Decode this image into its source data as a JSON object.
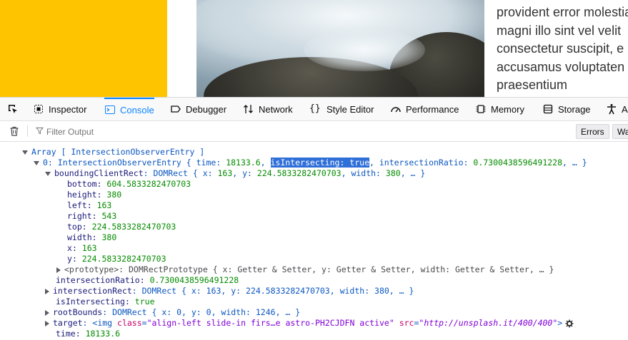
{
  "page": {
    "text_lines": [
      "provident error molestiae",
      "magni illo sint vel velit",
      "consectetur suscipit, e",
      "accusamus voluptaten",
      "praesentium"
    ]
  },
  "devtools": {
    "tabs": [
      {
        "label": "Inspector",
        "icon": "inspector-icon"
      },
      {
        "label": "Console",
        "icon": "console-icon",
        "active": true
      },
      {
        "label": "Debugger",
        "icon": "debugger-icon"
      },
      {
        "label": "Network",
        "icon": "network-icon"
      },
      {
        "label": "Style Editor",
        "icon": "style-editor-icon"
      },
      {
        "label": "Performance",
        "icon": "performance-icon"
      },
      {
        "label": "Memory",
        "icon": "memory-icon"
      },
      {
        "label": "Storage",
        "icon": "storage-icon"
      },
      {
        "label": "A",
        "icon": "accessibility-icon"
      }
    ],
    "filter": {
      "placeholder": "Filter Output"
    },
    "buttons": {
      "errors": "Errors",
      "warnings": "Wa"
    },
    "colors": {
      "accent": "#0a84ff",
      "yellow_block": "#ffc400",
      "selection": "#2f6fd8"
    }
  },
  "console": {
    "array_label": "Array [ IntersectionObserverEntry ]",
    "entry_prefix": "0: IntersectionObserverEntry { time: ",
    "entry_time": "18133.6",
    "entry_sep": ", ",
    "entry_selected": "isIntersecting: true",
    "entry_ratio_key": ", intersectionRatio: ",
    "entry_ratio": "0.7300438596491228",
    "entry_suffix": ", … }",
    "bcr_key": "boundingClientRect",
    "bcr_summary_prefix": ": DOMRect { x: ",
    "bcr_x": "163",
    "bcr_y_key": ", y: ",
    "bcr_y": "224.5833282470703",
    "bcr_w_key": ", width: ",
    "bcr_w": "380",
    "bcr_end": ", … }",
    "props": [
      {
        "key": "bottom",
        "value": "604.5833282470703"
      },
      {
        "key": "height",
        "value": "380"
      },
      {
        "key": "left",
        "value": "163"
      },
      {
        "key": "right",
        "value": "543"
      },
      {
        "key": "top",
        "value": "224.5833282470703"
      },
      {
        "key": "width",
        "value": "380"
      },
      {
        "key": "x",
        "value": "163"
      },
      {
        "key": "y",
        "value": "224.5833282470703"
      }
    ],
    "prototype_line": "<prototype>: DOMRectPrototype { x: Getter & Setter, y: Getter & Setter, width: Getter & Setter, … }",
    "ratio_key": "intersectionRatio",
    "ratio_value": "0.7300438596491228",
    "irect_key": "intersectionRect",
    "irect_summary": ": DOMRect { x: 163, y: 224.5833282470703, width: 380, … }",
    "isint_key": "isIntersecting",
    "isint_value": "true",
    "root_key": "rootBounds",
    "root_summary": ": DOMRect { x: 0, y: 0, width: 1246, … }",
    "target_key": "target",
    "target_tag_open": ": <img ",
    "target_attr1": "class",
    "target_val1": "\"align-left slide-in firs…e astro-PH2CJDFN active\"",
    "target_attr2": "src",
    "target_val2": "\"http://unsplash.it/400/400\"",
    "target_tag_close": ">",
    "time_key": "time",
    "time_value": "18133.6"
  }
}
